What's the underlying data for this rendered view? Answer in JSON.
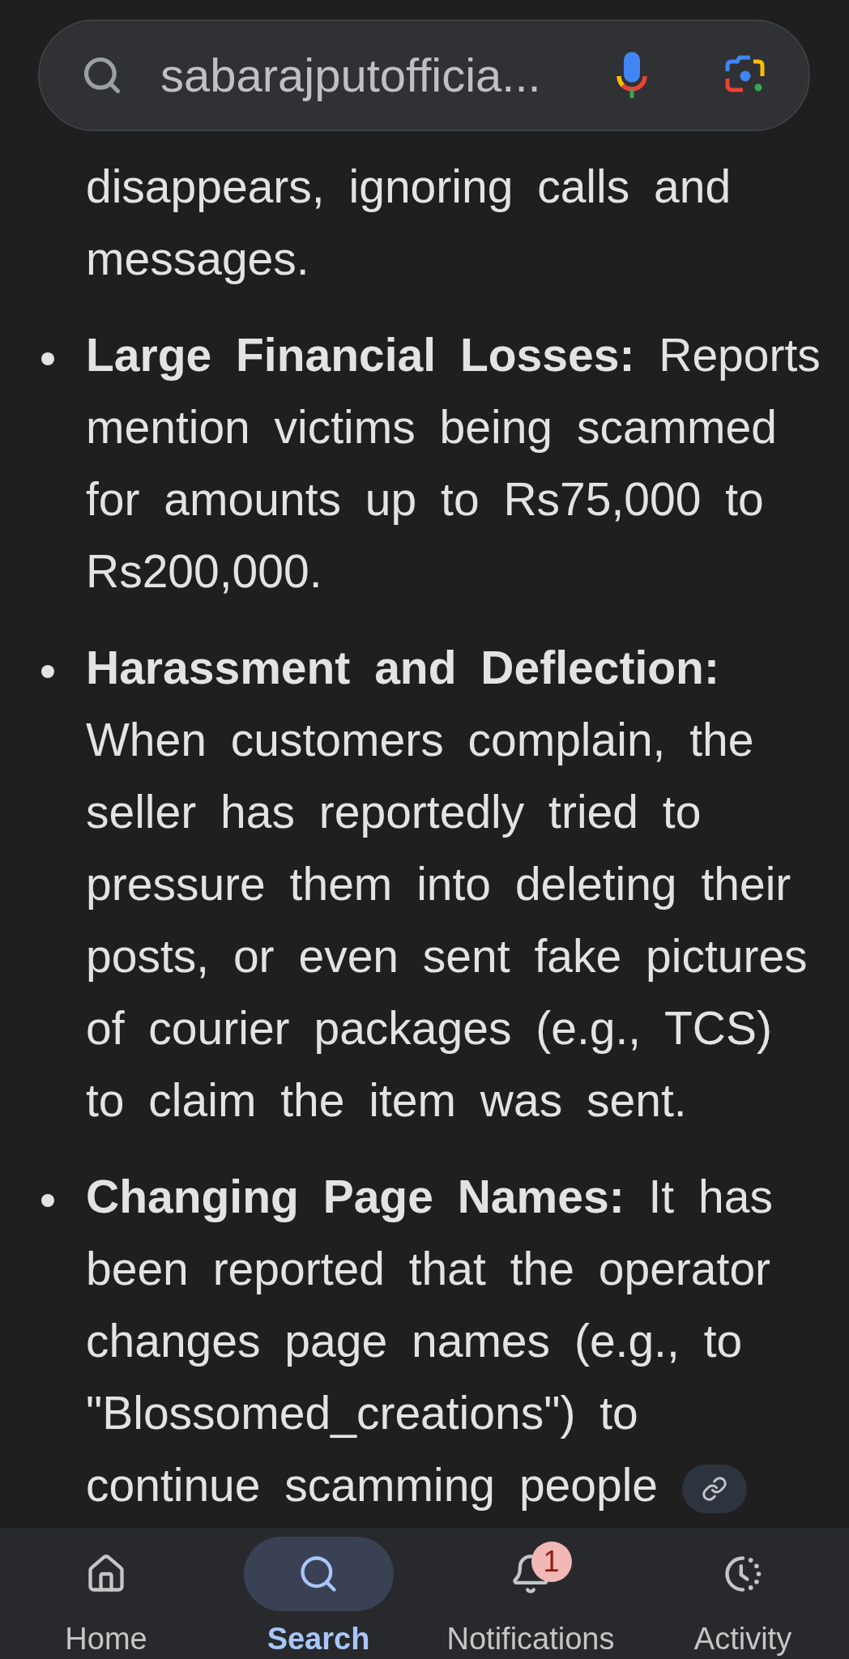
{
  "search_bar": {
    "query": "sabarajputofficia..."
  },
  "answer": {
    "continued_text": "disappears, ignoring calls and messages.",
    "bullets": [
      {
        "text": "**Large Financial Losses:** Reports mention victims being scammed for amounts up to Rs75,000 to Rs200,000.",
        "source_link": false
      },
      {
        "text": "**Harassment and Deflection:** When customers complain, the seller has reportedly tried to pressure them into deleting their posts, or even sent fake pictures of courier packages (e.g., TCS) to claim the item was sent.",
        "source_link": false
      },
      {
        "text": "**Changing Page Names:** It has been reported that the operator changes page names (e.g., to \"Blossomed_creations\") to continue scamming people",
        "source_link": true
      }
    ]
  },
  "bottom_nav": {
    "tabs": [
      {
        "label": "Home",
        "selected": false
      },
      {
        "label": "Search",
        "selected": true
      },
      {
        "label": "Notifications",
        "selected": false,
        "badge": "1"
      },
      {
        "label": "Activity",
        "selected": false
      }
    ]
  }
}
